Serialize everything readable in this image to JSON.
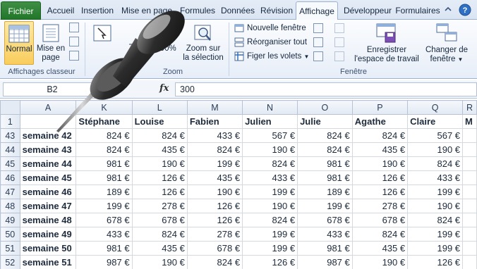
{
  "tabs": [
    "Fichier",
    "Accueil",
    "Insertion",
    "Mise en page",
    "Formules",
    "Données",
    "Révision",
    "Affichage",
    "Développeur",
    "Formulaires"
  ],
  "active_tab": "Affichage",
  "ribbon": {
    "groups": {
      "views": "Affichages classeur",
      "zoom": "Zoom",
      "window": "Fenêtre"
    },
    "normal": "Normal",
    "page_layout_line1": "Mise en",
    "page_layout_line2": "page",
    "zoom_btn": "Zoom",
    "zoom_100": "100%",
    "zoom_sel_line1": "Zoom sur",
    "zoom_sel_line2": "la sélection",
    "new_window": "Nouvelle fenêtre",
    "arrange_all": "Réorganiser tout",
    "freeze_panes": "Figer les volets",
    "save_workspace_line1": "Enregistrer",
    "save_workspace_line2": "l'espace de travail",
    "switch_windows_line1": "Changer de",
    "switch_windows_line2": "fenêtre"
  },
  "formula_bar": {
    "cell_ref": "B2",
    "fx": "fx",
    "value": "300"
  },
  "grid": {
    "col_letters": [
      "A",
      "K",
      "L",
      "M",
      "N",
      "O",
      "P",
      "Q",
      "R"
    ],
    "row_numbers": [
      "1",
      "43",
      "44",
      "45",
      "46",
      "47",
      "48",
      "49",
      "50",
      "51",
      "52"
    ],
    "headers": [
      "",
      "Stéphane",
      "Louise",
      "Fabien",
      "Julien",
      "Julie",
      "Agathe",
      "Claire",
      "M"
    ],
    "rows": [
      [
        "semaine 42",
        "824 €",
        "824 €",
        "433 €",
        "567 €",
        "824 €",
        "824 €",
        "567 €"
      ],
      [
        "semaine 43",
        "824 €",
        "435 €",
        "824 €",
        "190 €",
        "824 €",
        "435 €",
        "190 €"
      ],
      [
        "semaine 44",
        "981 €",
        "190 €",
        "199 €",
        "824 €",
        "981 €",
        "190 €",
        "824 €"
      ],
      [
        "semaine 45",
        "981 €",
        "126 €",
        "435 €",
        "433 €",
        "981 €",
        "126 €",
        "433 €"
      ],
      [
        "semaine 46",
        "189 €",
        "126 €",
        "190 €",
        "199 €",
        "189 €",
        "126 €",
        "199 €"
      ],
      [
        "semaine 47",
        "199 €",
        "278 €",
        "126 €",
        "190 €",
        "199 €",
        "278 €",
        "190 €"
      ],
      [
        "semaine 48",
        "678 €",
        "678 €",
        "126 €",
        "824 €",
        "678 €",
        "678 €",
        "824 €"
      ],
      [
        "semaine 49",
        "433 €",
        "824 €",
        "278 €",
        "199 €",
        "433 €",
        "824 €",
        "199 €"
      ],
      [
        "semaine 50",
        "981 €",
        "435 €",
        "678 €",
        "199 €",
        "981 €",
        "435 €",
        "199 €"
      ],
      [
        "semaine 51",
        "987 €",
        "190 €",
        "824 €",
        "126 €",
        "987 €",
        "190 €",
        "126 €"
      ]
    ]
  },
  "colors": {
    "file_tab": "#2a7d31",
    "ribbon_bg": "#e7eef8",
    "selected_button": "#f9cd5d"
  }
}
